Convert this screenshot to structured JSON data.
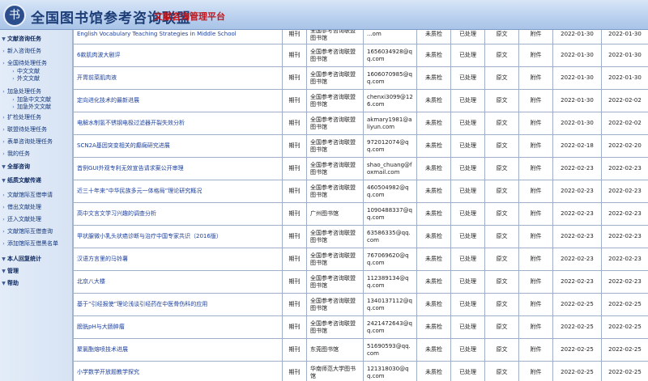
{
  "header": {
    "logo_icon": "library-alliance-logo",
    "title": "全国图书馆参考咨询联盟",
    "subtitle": "文献咨询管理平台"
  },
  "sidebar": {
    "items": [
      {
        "label": "文献咨询任务",
        "type": "section"
      },
      {
        "label": "新入咨询任务",
        "type": "item"
      },
      {
        "label": "全国待处理任务",
        "type": "item"
      },
      {
        "label": "中文文献",
        "type": "sub"
      },
      {
        "label": "外文文献",
        "type": "sub"
      },
      {
        "label": "加急处理任务",
        "type": "item"
      },
      {
        "label": "加急中文文献",
        "type": "sub"
      },
      {
        "label": "加急外文文献",
        "type": "sub"
      },
      {
        "label": "扩检处理任务",
        "type": "item"
      },
      {
        "label": "联盟待处理任务",
        "type": "item"
      },
      {
        "label": "表单咨询处理任务",
        "type": "item"
      },
      {
        "label": "我的任务",
        "type": "item"
      },
      {
        "label": "全部咨询",
        "type": "section"
      },
      {
        "label": "纸质文献传递",
        "type": "section"
      },
      {
        "label": "文献馆际互借申请",
        "type": "item"
      },
      {
        "label": "借出文献处理",
        "type": "item"
      },
      {
        "label": "还入文献处理",
        "type": "item"
      },
      {
        "label": "文献馆际互借查询",
        "type": "item"
      },
      {
        "label": "添加馆际互借黑名单",
        "type": "item"
      },
      {
        "label": "本人回复统计",
        "type": "section"
      },
      {
        "label": "管理",
        "type": "section"
      },
      {
        "label": "帮助",
        "type": "section"
      }
    ]
  },
  "table": {
    "rows": [
      {
        "title": "English Vocabulary Teaching Strategies in Middle School",
        "type": "期刊",
        "library": "全国参考咨询联盟图书馆",
        "email": "...om",
        "check": "未质检",
        "status": "已处理",
        "form": "原文",
        "attach": "附件",
        "date1": "2022-01-30",
        "date2": "2022-01-30"
      },
      {
        "title": "6款肌肉波大剧评",
        "type": "期刊",
        "library": "全国参考咨询联盟图书馆",
        "email": "1656034928@qq.com",
        "check": "未质检",
        "status": "已处理",
        "form": "原文",
        "attach": "附件",
        "date1": "2022-01-30",
        "date2": "2022-01-30"
      },
      {
        "title": "开胃前菜肌肉液",
        "type": "期刊",
        "library": "全国参考咨询联盟图书馆",
        "email": "1606070985@qq.com",
        "check": "未质检",
        "status": "已处理",
        "form": "原文",
        "attach": "附件",
        "date1": "2022-01-30",
        "date2": "2022-01-30"
      },
      {
        "title": "定向进化技术的最新进展",
        "type": "期刊",
        "library": "全国参考咨询联盟图书馆",
        "email": "chenxi3099@126.com",
        "check": "未质检",
        "status": "已处理",
        "form": "原文",
        "attach": "附件",
        "date1": "2022-01-30",
        "date2": "2022-02-02"
      },
      {
        "title": "电解水制氢不锈钢电极过滤器开裂失效分析",
        "type": "期刊",
        "library": "全国参考咨询联盟图书馆",
        "email": "akmary1981@aliyun.com",
        "check": "未质检",
        "status": "已处理",
        "form": "原文",
        "attach": "附件",
        "date1": "2022-01-30",
        "date2": "2022-02-02"
      },
      {
        "title": "SCN2A基因突变相关的癫痫研究进展",
        "type": "期刊",
        "library": "全国参考咨询联盟图书馆",
        "email": "972012074@qq.com",
        "check": "未质检",
        "status": "已处理",
        "form": "原文",
        "attach": "附件",
        "date1": "2022-02-18",
        "date2": "2022-02-20"
      },
      {
        "title": "首例GUI外观专利无效宣告请求案公开审理",
        "type": "期刊",
        "library": "全国参考咨询联盟图书馆",
        "email": "shao_chuang@foxmail.com",
        "check": "未质检",
        "status": "已处理",
        "form": "原文",
        "attach": "附件",
        "date1": "2022-02-23",
        "date2": "2022-02-23"
      },
      {
        "title": "近三十年来“中华民族多元一体格局”理论研究概况",
        "type": "期刊",
        "library": "全国参考咨询联盟图书馆",
        "email": "460504982@qq.com",
        "check": "未质检",
        "status": "已处理",
        "form": "原文",
        "attach": "附件",
        "date1": "2022-02-23",
        "date2": "2022-02-23"
      },
      {
        "title": "高中文言文学习兴趣的调查分析",
        "type": "期刊",
        "library": "广州图书馆",
        "email": "1090488337@qq.com",
        "check": "未质检",
        "status": "已处理",
        "form": "原文",
        "attach": "附件",
        "date1": "2022-02-23",
        "date2": "2022-02-23"
      },
      {
        "title": "甲状腺微小乳头状癌诊断与治疗中国专家共识（2016版）",
        "type": "期刊",
        "library": "全国参考咨询联盟图书馆",
        "email": "63586335@qq.com",
        "check": "未质检",
        "status": "已处理",
        "form": "原文",
        "attach": "附件",
        "date1": "2022-02-23",
        "date2": "2022-02-23"
      },
      {
        "title": "汉语方言里的马铃薯",
        "type": "期刊",
        "library": "全国参考咨询联盟图书馆",
        "email": "767069620@qq.com",
        "check": "未质检",
        "status": "已处理",
        "form": "原文",
        "attach": "附件",
        "date1": "2022-02-23",
        "date2": "2022-02-23"
      },
      {
        "title": "北京八大楼",
        "type": "期刊",
        "library": "全国参考咨询联盟图书馆",
        "email": "112389134@qq.com",
        "check": "未质检",
        "status": "已处理",
        "form": "原文",
        "attach": "附件",
        "date1": "2022-02-23",
        "date2": "2022-02-23"
      },
      {
        "title": "基于“引经报使”理论浅谈引经药在中医骨伤科的应用",
        "type": "期刊",
        "library": "全国参考咨询联盟图书馆",
        "email": "1340137112@qq.com",
        "check": "未质检",
        "status": "已处理",
        "form": "原文",
        "attach": "附件",
        "date1": "2022-02-25",
        "date2": "2022-02-25"
      },
      {
        "title": "膀胱pH与大肠肿瘤",
        "type": "期刊",
        "library": "全国参考咨询联盟图书馆",
        "email": "2421472643@qq.com",
        "check": "未质检",
        "status": "已处理",
        "form": "原文",
        "attach": "附件",
        "date1": "2022-02-25",
        "date2": "2022-02-25"
      },
      {
        "title": "聚氯酯熔喷技术进展",
        "type": "期刊",
        "library": "东莞图书馆",
        "email": "51690593@qq.com",
        "check": "未质检",
        "status": "已处理",
        "form": "原文",
        "attach": "附件",
        "date1": "2022-02-25",
        "date2": "2022-02-25"
      },
      {
        "title": "小学数学开放题教学探究",
        "type": "期刊",
        "library": "华南师范大学图书馆",
        "email": "121318030@qq.com",
        "check": "未质检",
        "status": "已处理",
        "form": "原文",
        "attach": "附件",
        "date1": "2022-02-25",
        "date2": "2022-02-25"
      }
    ]
  }
}
